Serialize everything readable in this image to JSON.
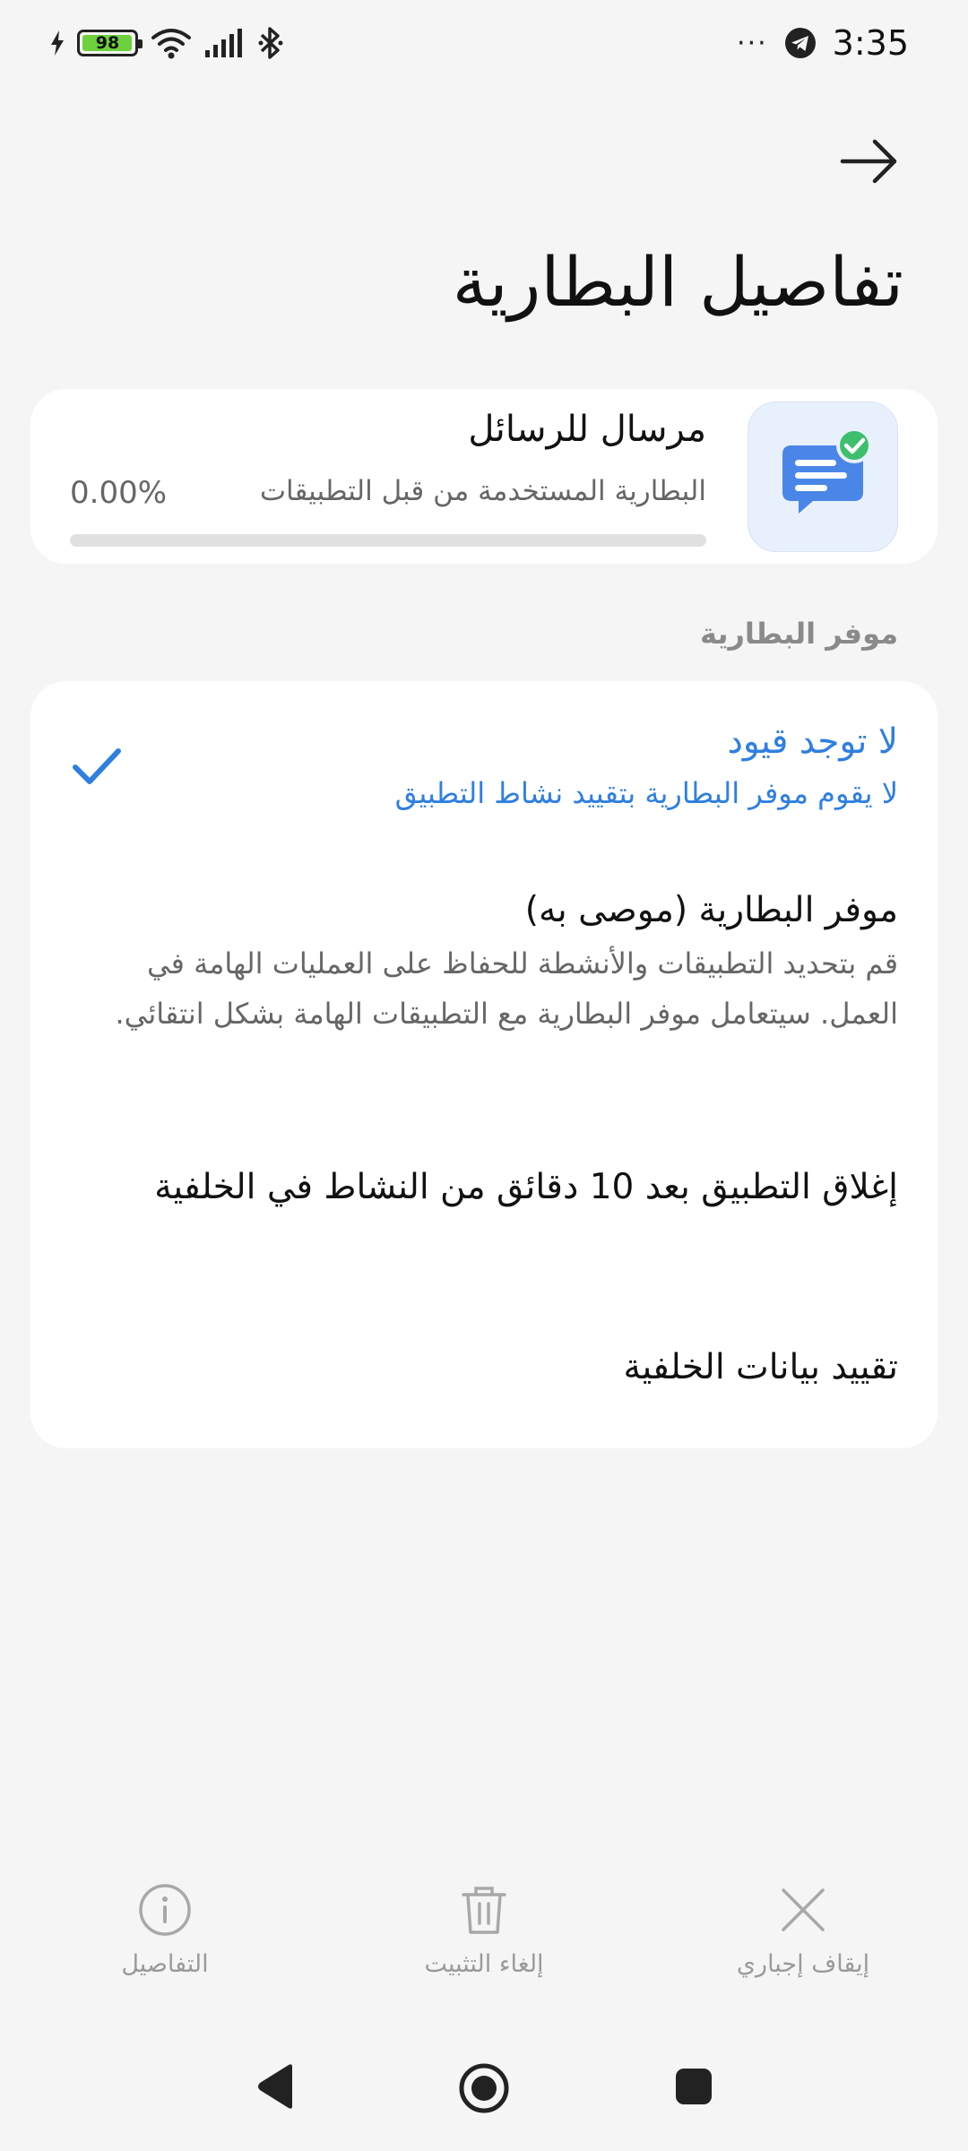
{
  "status_bar": {
    "battery_level": "98",
    "time": "3:35",
    "overflow_dots": "···",
    "icons": [
      "charging-bolt-icon",
      "battery-icon",
      "wifi-icon",
      "signal-icon",
      "bluetooth-icon",
      "telegram-icon"
    ]
  },
  "header": {
    "title": "تفاصيل البطارية",
    "back_icon": "arrow-icon"
  },
  "app": {
    "name": "مرسال للرسائل",
    "usage_label": "البطارية المستخدمة من قبل التطبيقات",
    "usage_percent": "0.00%",
    "usage_fraction": 0.0,
    "icon": "messages-app-icon",
    "icon_colors": {
      "bubble": "#4a86e8",
      "badge": "#3dbf6e",
      "tile": "#e8f0fc"
    }
  },
  "battery_saver": {
    "section_label": "موفر البطارية",
    "options": [
      {
        "title": "لا توجد قيود",
        "description": "لا يقوم موفر البطارية بتقييد نشاط التطبيق",
        "selected": true
      },
      {
        "title": "موفر البطارية (موصى به)",
        "description": "قم بتحديد التطبيقات والأنشطة للحفاظ على العمليات الهامة في العمل. سيتعامل موفر البطارية مع التطبيقات الهامة بشكل انتقائي.",
        "selected": false
      },
      {
        "title": "إغلاق التطبيق بعد 10 دقائق من النشاط في الخلفية",
        "description": "",
        "selected": false
      },
      {
        "title": "تقييد بيانات الخلفية",
        "description": "",
        "selected": false
      }
    ],
    "accent_color": "#2f7fe0"
  },
  "actions": {
    "details_label": "التفاصيل",
    "uninstall_label": "إلغاء التثبيت",
    "force_stop_label": "إيقاف إجباري"
  },
  "navigation": {
    "icons": [
      "back-triangle-icon",
      "home-circle-icon",
      "recents-square-icon"
    ]
  }
}
